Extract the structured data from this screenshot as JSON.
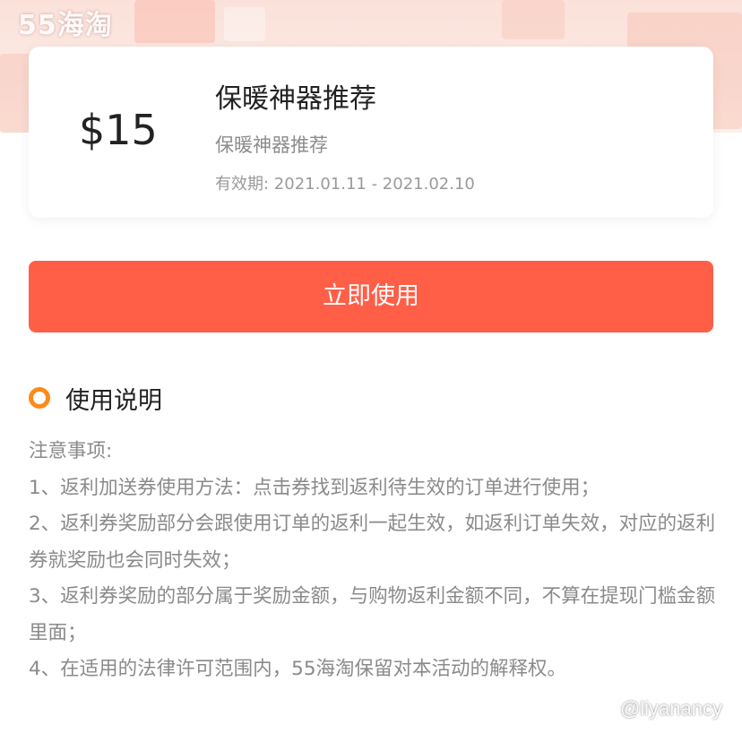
{
  "watermark": {
    "logo_text": "55海淘",
    "credit_text": "@liyanancy"
  },
  "coupon": {
    "amount": "$15",
    "title": "保暖神器推荐",
    "subtitle": "保暖神器推荐",
    "validity": "有效期: 2021.01.11 - 2021.02.10"
  },
  "actions": {
    "use_now_label": "立即使用"
  },
  "instructions": {
    "section_title": "使用说明",
    "notes": [
      "注意事项:",
      "1、返利加送券使用方法：点击券找到返利待生效的订单进行使用；",
      "2、返利券奖励部分会跟使用订单的返利一起生效，如返利订单失效，对应的返利券就奖励也会同时失效；",
      "3、返利券奖励的部分属于奖励金额，与购物返利金额不同，不算在提现门槛金额里面；",
      "4、在适用的法律许可范围内，55海淘保留对本活动的解释权。"
    ]
  },
  "colors": {
    "primary_button": "#ff5e47",
    "section_ring": "#ff8a1a",
    "header_tint": "#fbe1da"
  },
  "icons": {
    "section_marker": "ring-icon"
  }
}
